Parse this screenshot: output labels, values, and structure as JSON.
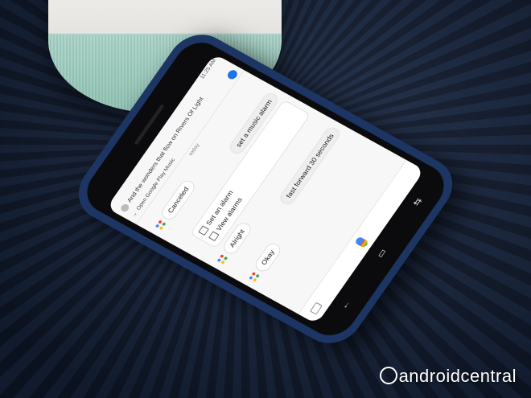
{
  "status_bar": {
    "time": "11:25 AM"
  },
  "now_playing": {
    "text": "And the wonders that flow on Rivers Of Light"
  },
  "open_music": {
    "label": "Open Google Play Music"
  },
  "divider_label": "today",
  "messages": [
    {
      "from": "assistant",
      "text": "Canceled"
    },
    {
      "from": "user",
      "text": "set a music alarm"
    },
    {
      "from": "assistant",
      "text": "Alright"
    },
    {
      "from": "user",
      "text": "fast forward 30 seconds"
    },
    {
      "from": "assistant",
      "text": "Okay"
    }
  ],
  "alarm_card": {
    "items": [
      {
        "label": "Set an alarm",
        "icon": "alarm-plus-icon"
      },
      {
        "label": "View alarms",
        "icon": "alarm-list-icon"
      }
    ]
  },
  "nav": {
    "back_icon": "back-icon",
    "home_icon": "home-icon",
    "recents_icon": "recents-icon"
  },
  "watermark": {
    "text": "androidcentral"
  },
  "colors": {
    "assistant_blue": "#4285f4",
    "assistant_red": "#ea4335",
    "assistant_yellow": "#fbbc05",
    "assistant_green": "#34a853",
    "case_blue": "#1c3563"
  }
}
